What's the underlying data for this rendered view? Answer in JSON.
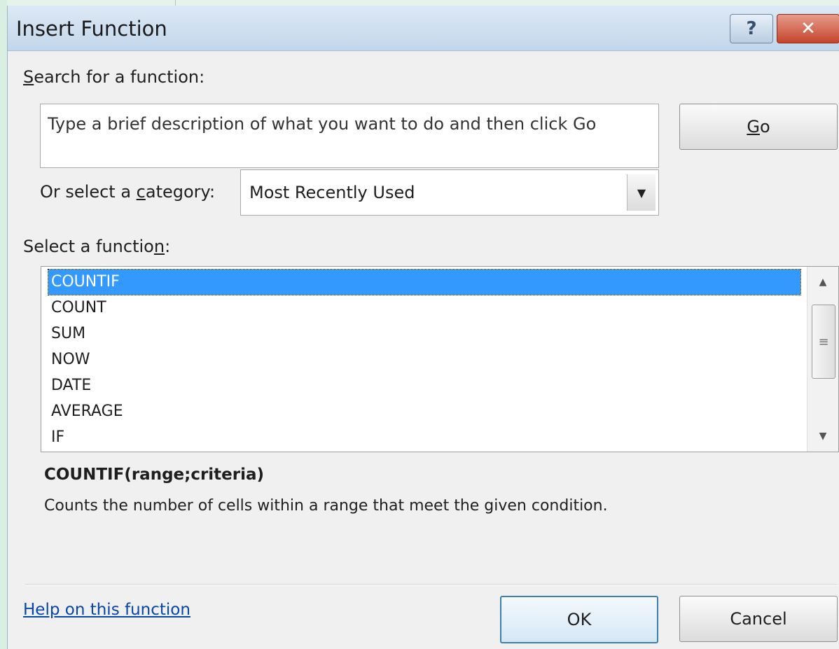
{
  "dialog": {
    "title": "Insert Function",
    "help_glyph": "?",
    "close_glyph": "✕"
  },
  "search": {
    "label_accel": "S",
    "label_rest": "earch for a function:",
    "value": "Type a brief description of what you want to do and then click Go",
    "go_accel": "G",
    "go_rest": "o"
  },
  "category": {
    "label_pre": "Or select a ",
    "label_accel": "c",
    "label_post": "ategory:",
    "selected": "Most Recently Used"
  },
  "functions": {
    "label_pre": "Select a functio",
    "label_accel": "n",
    "label_post": ":",
    "items": [
      "COUNTIF",
      "COUNT",
      "SUM",
      "NOW",
      "DATE",
      "AVERAGE",
      "IF"
    ],
    "selected_index": 0,
    "syntax": "COUNTIF(range;criteria)",
    "description": "Counts the number of cells within a range that meet the given condition."
  },
  "footer": {
    "help_link": "Help on this function",
    "ok": "OK",
    "cancel": "Cancel"
  },
  "icons": {
    "dropdown_arrow": "▼",
    "scroll_up": "▲",
    "scroll_down": "▼",
    "scroll_grip": "≡"
  },
  "colors": {
    "selection": "#3399ff",
    "link": "#0645ad",
    "close_button": "#c4452d"
  }
}
